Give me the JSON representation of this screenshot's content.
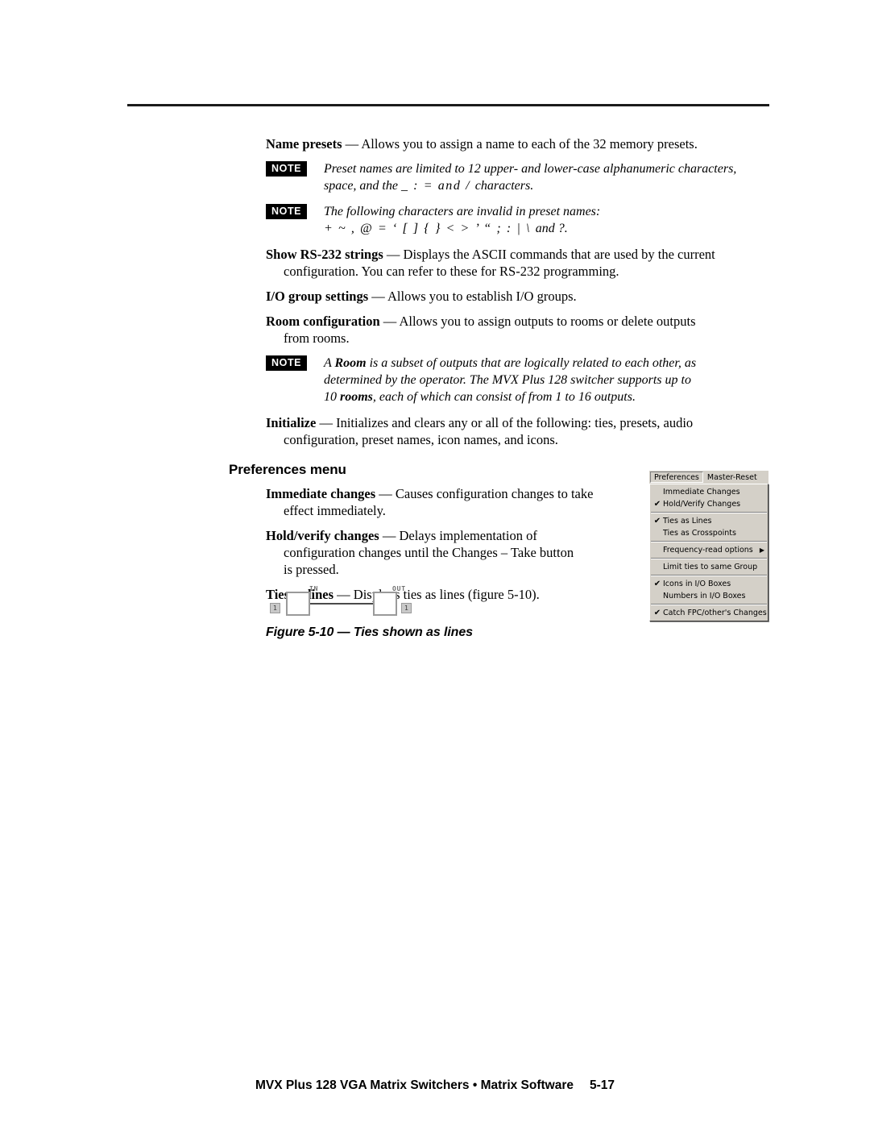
{
  "document": {
    "footer_title": "MVX Plus 128 VGA Matrix Switchers • Matrix Software",
    "page_number": "5-17"
  },
  "body": {
    "name_presets": {
      "lead": "Name presets",
      "text": " — Allows you to assign a name to each of the 32 memory presets."
    },
    "note_1": {
      "tag": "NOTE",
      "line1": "Preset names are limited to 12 upper- and lower-case alphanumeric characters,",
      "line2_a": "space, and the ",
      "line2_sym": "_ : = and / ",
      "line2_b": "characters."
    },
    "note_2": {
      "tag": "NOTE",
      "line1": "The following characters are invalid in preset names:",
      "line2_sym": "+ ~ , @ = ‘ [ ] { } < > ’ “ ; : | \\ ",
      "line2_b": "and ?."
    },
    "show_rs232": {
      "lead": "Show RS-232 strings",
      "text": " — Displays the ASCII commands that are used by the current",
      "cont": "configuration.  You can refer to these for RS-232 programming."
    },
    "io_group": {
      "lead": "I/O group settings",
      "text": " — Allows you to establish I/O groups."
    },
    "room_config": {
      "lead": "Room configuration",
      "text": " — Allows you to assign outputs to rooms or delete outputs",
      "cont": "from rooms."
    },
    "note_3": {
      "tag": "NOTE",
      "line1_a": "A ",
      "line1_b": "Room",
      "line1_c": " is a subset of outputs that are logically related to each other, as",
      "line2": "determined by the operator.  The MVX Plus 128 switcher supports up to",
      "line3_a": "10 ",
      "line3_b": "rooms",
      "line3_c": ", each of which can consist of from 1 to 16 outputs."
    },
    "initialize": {
      "lead": "Initialize",
      "text": " — Initializes and clears any or all of the following: ties, presets, audio",
      "cont": "configuration, preset names, icon names, and icons."
    }
  },
  "preferences_section": {
    "heading": "Preferences menu",
    "items": [
      {
        "lead": "Immediate changes",
        "text": " — Causes configuration changes to take",
        "cont": "effect immediately."
      },
      {
        "lead": "Hold/verify changes",
        "text": " — Delays implementation of",
        "cont": "configuration changes until the Changes – Take button",
        "cont2": "is pressed."
      },
      {
        "lead": "Ties as lines",
        "text": " — Displays ties as lines (figure 5-10)."
      }
    ]
  },
  "figure": {
    "caption": "Figure 5-10 — Ties shown as lines",
    "in_label": "IN",
    "out_label": "OUT",
    "in_number": "1",
    "out_number": "1"
  },
  "menu_screenshot": {
    "menubar": [
      {
        "label": "Preferences",
        "active": true
      },
      {
        "label": "Master-Reset",
        "active": false
      }
    ],
    "items": [
      {
        "label": "Immediate Changes",
        "checked": false,
        "submenu": false
      },
      {
        "label": "Hold/Verify Changes",
        "checked": true,
        "submenu": false
      },
      {
        "separator": true
      },
      {
        "label": "Ties as Lines",
        "checked": true,
        "submenu": false
      },
      {
        "label": "Ties as Crosspoints",
        "checked": false,
        "submenu": false
      },
      {
        "separator": true
      },
      {
        "label": "Frequency-read options",
        "checked": false,
        "submenu": true
      },
      {
        "separator": true
      },
      {
        "label": "Limit ties to same Group",
        "checked": false,
        "submenu": false
      },
      {
        "separator": true
      },
      {
        "label": "Icons in I/O Boxes",
        "checked": true,
        "submenu": false
      },
      {
        "label": "Numbers in I/O Boxes",
        "checked": false,
        "submenu": false
      },
      {
        "separator": true
      },
      {
        "label": "Catch FPC/other's Changes",
        "checked": true,
        "submenu": false
      }
    ],
    "check_glyph": "✔",
    "submenu_glyph": "▶",
    "colors": {
      "face": "#d4d0c8",
      "shadow": "#808080",
      "highlight": "#ffffff"
    }
  }
}
